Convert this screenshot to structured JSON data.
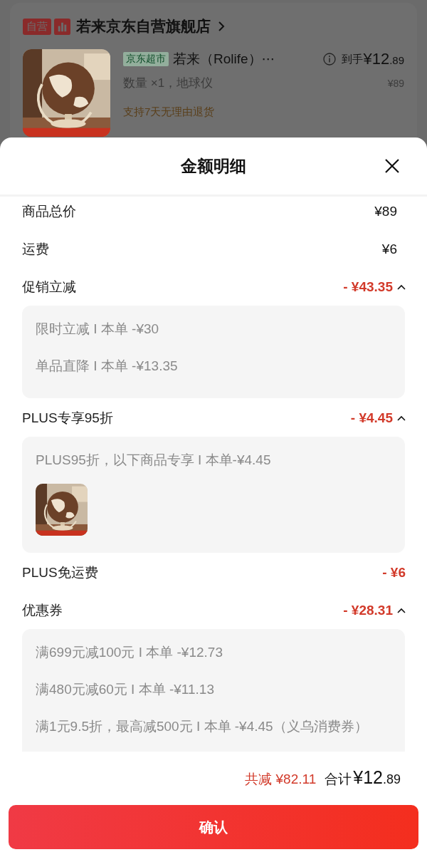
{
  "background_page": {
    "store": {
      "badge": "自营",
      "name": "若来京东自营旗舰店"
    },
    "product": {
      "image": {
        "kind": "picture"
      },
      "tag": "京东超市",
      "title": "若来（Rolife）⋯",
      "spec": "数量 ×1，地球仪",
      "final_label": "到手",
      "final_price": "¥12.89",
      "original_price": "¥89",
      "return_policy": "支持7天无理由退货"
    }
  },
  "sheet": {
    "title": "金额明细",
    "rows": [
      {
        "label": "商品总价",
        "amount": "¥89",
        "kind": "plain"
      },
      {
        "label": "运费",
        "amount": "¥6",
        "kind": "plain"
      },
      {
        "label": "促销立减",
        "amount": "- ¥43.35",
        "kind": "discount",
        "expanded": true,
        "details": [
          "限时立减 I 本单 -¥30",
          "单品直降 I 本单 -¥13.35"
        ]
      },
      {
        "label": "PLUS专享95折",
        "amount": "- ¥4.45",
        "kind": "discount",
        "expanded": true,
        "details": [
          "PLUS95折，以下商品专享 I 本单-¥4.45"
        ],
        "thumbnail": {
          "kind": "picture"
        }
      },
      {
        "label": "PLUS免运费",
        "amount": "- ¥6",
        "kind": "discount"
      },
      {
        "label": "优惠券",
        "amount": "- ¥28.31",
        "kind": "discount",
        "expanded": true,
        "details": [
          "满699元减100元 I 本单 -¥12.73",
          "满480元减60元 I 本单 -¥11.13",
          "满1元9.5折，最高减500元 I 本单 -¥4.45（义乌消费券）"
        ]
      }
    ],
    "footer": {
      "total_discount": "共减 ¥82.11",
      "total_label": "合计",
      "total": "¥12.89",
      "confirm_button": "确认"
    }
  }
}
